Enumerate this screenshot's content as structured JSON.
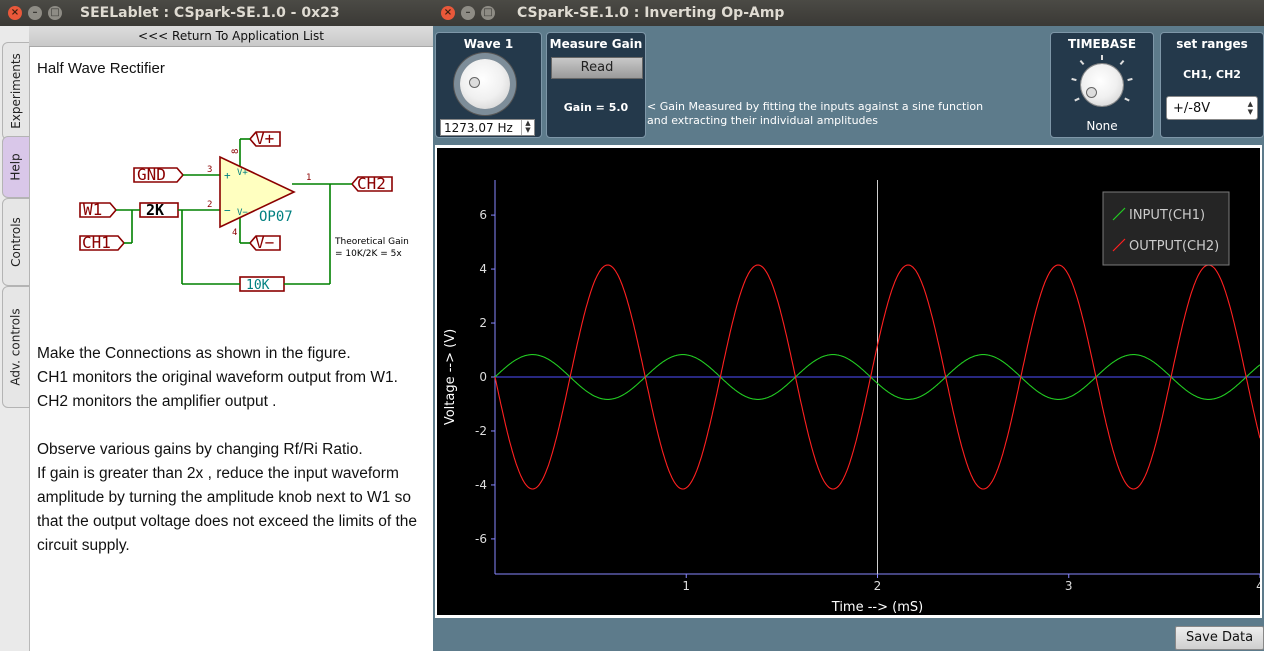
{
  "left_window": {
    "title": "SEELablet : CSpark-SE.1.0 - 0x23",
    "tabs": [
      "Experiments",
      "Help",
      "Controls",
      "Adv. controls"
    ],
    "active_tab": "Help",
    "back_link": "<<< Return To Application List",
    "help": {
      "title": "Half Wave Rectifier",
      "schematic": {
        "labels": {
          "vplus": "V+",
          "vminus": "V−",
          "gnd": "GND",
          "w1": "W1",
          "ch1": "CH1",
          "ch2": "CH2",
          "ri": "2K",
          "rf": "10K",
          "opamp": "OP07",
          "pin3": "3",
          "pin2": "2",
          "pin8": "8",
          "pin4": "4",
          "pin1": "1",
          "plus_sign": "+",
          "minus_sign": "−",
          "vplus_small": "V+",
          "vminus_small": "V−"
        },
        "note_line1": "Theoretical Gain",
        "note_line2": "= 10K/2K = 5x"
      },
      "para1": [
        "Make the Connections as shown in the figure.",
        "CH1 monitors the original waveform output from W1.",
        "CH2 monitors the amplifier output ."
      ],
      "para2": [
        "Observe various gains by changing Rf/Ri Ratio.",
        "If gain is greater than 2x , reduce the input waveform",
        "amplitude by turning the amplitude knob next to W1 so",
        "that the output voltage does not exceed the limits of the",
        "circuit supply."
      ]
    }
  },
  "right_window": {
    "title": "CSpark-SE.1.0 : Inverting Op-Amp",
    "wave_panel": {
      "title": "Wave 1",
      "frequency": "1273.07 Hz"
    },
    "gain_panel": {
      "title": "Measure Gain",
      "button": "Read",
      "result": "Gain = 5.0"
    },
    "gain_note": [
      "< Gain Measured by fitting the inputs against a sine function",
      "and extracting their individual amplitudes"
    ],
    "timebase_panel": {
      "title": "TIMEBASE",
      "value": "None"
    },
    "range_panel": {
      "title": "set ranges",
      "channels": "CH1, CH2",
      "selected": "+/-8V"
    },
    "save_button": "Save Data"
  },
  "chart_data": {
    "type": "line",
    "title": "",
    "xlabel": "Time --> (mS)",
    "ylabel": "Voltage --> (V)",
    "xlim": [
      0,
      4
    ],
    "ylim": [
      -7.3,
      7.3
    ],
    "xticks": [
      1,
      2,
      3,
      4
    ],
    "yticks": [
      6,
      4,
      2,
      0,
      -2,
      -4,
      -6
    ],
    "grid": false,
    "legend_position": "top-right",
    "series": [
      {
        "name": "INPUT(CH1)",
        "color": "#22cc22",
        "function": "sine",
        "amplitude": 0.83,
        "frequency_khz": 1.273,
        "phase_deg": 0
      },
      {
        "name": "OUTPUT(CH2)",
        "color": "#ff2020",
        "function": "sine",
        "amplitude": 4.15,
        "frequency_khz": 1.273,
        "phase_deg": 180
      }
    ],
    "x_zero_line_color": "#5050ff",
    "cursor_x": 2,
    "background": "#000000"
  }
}
